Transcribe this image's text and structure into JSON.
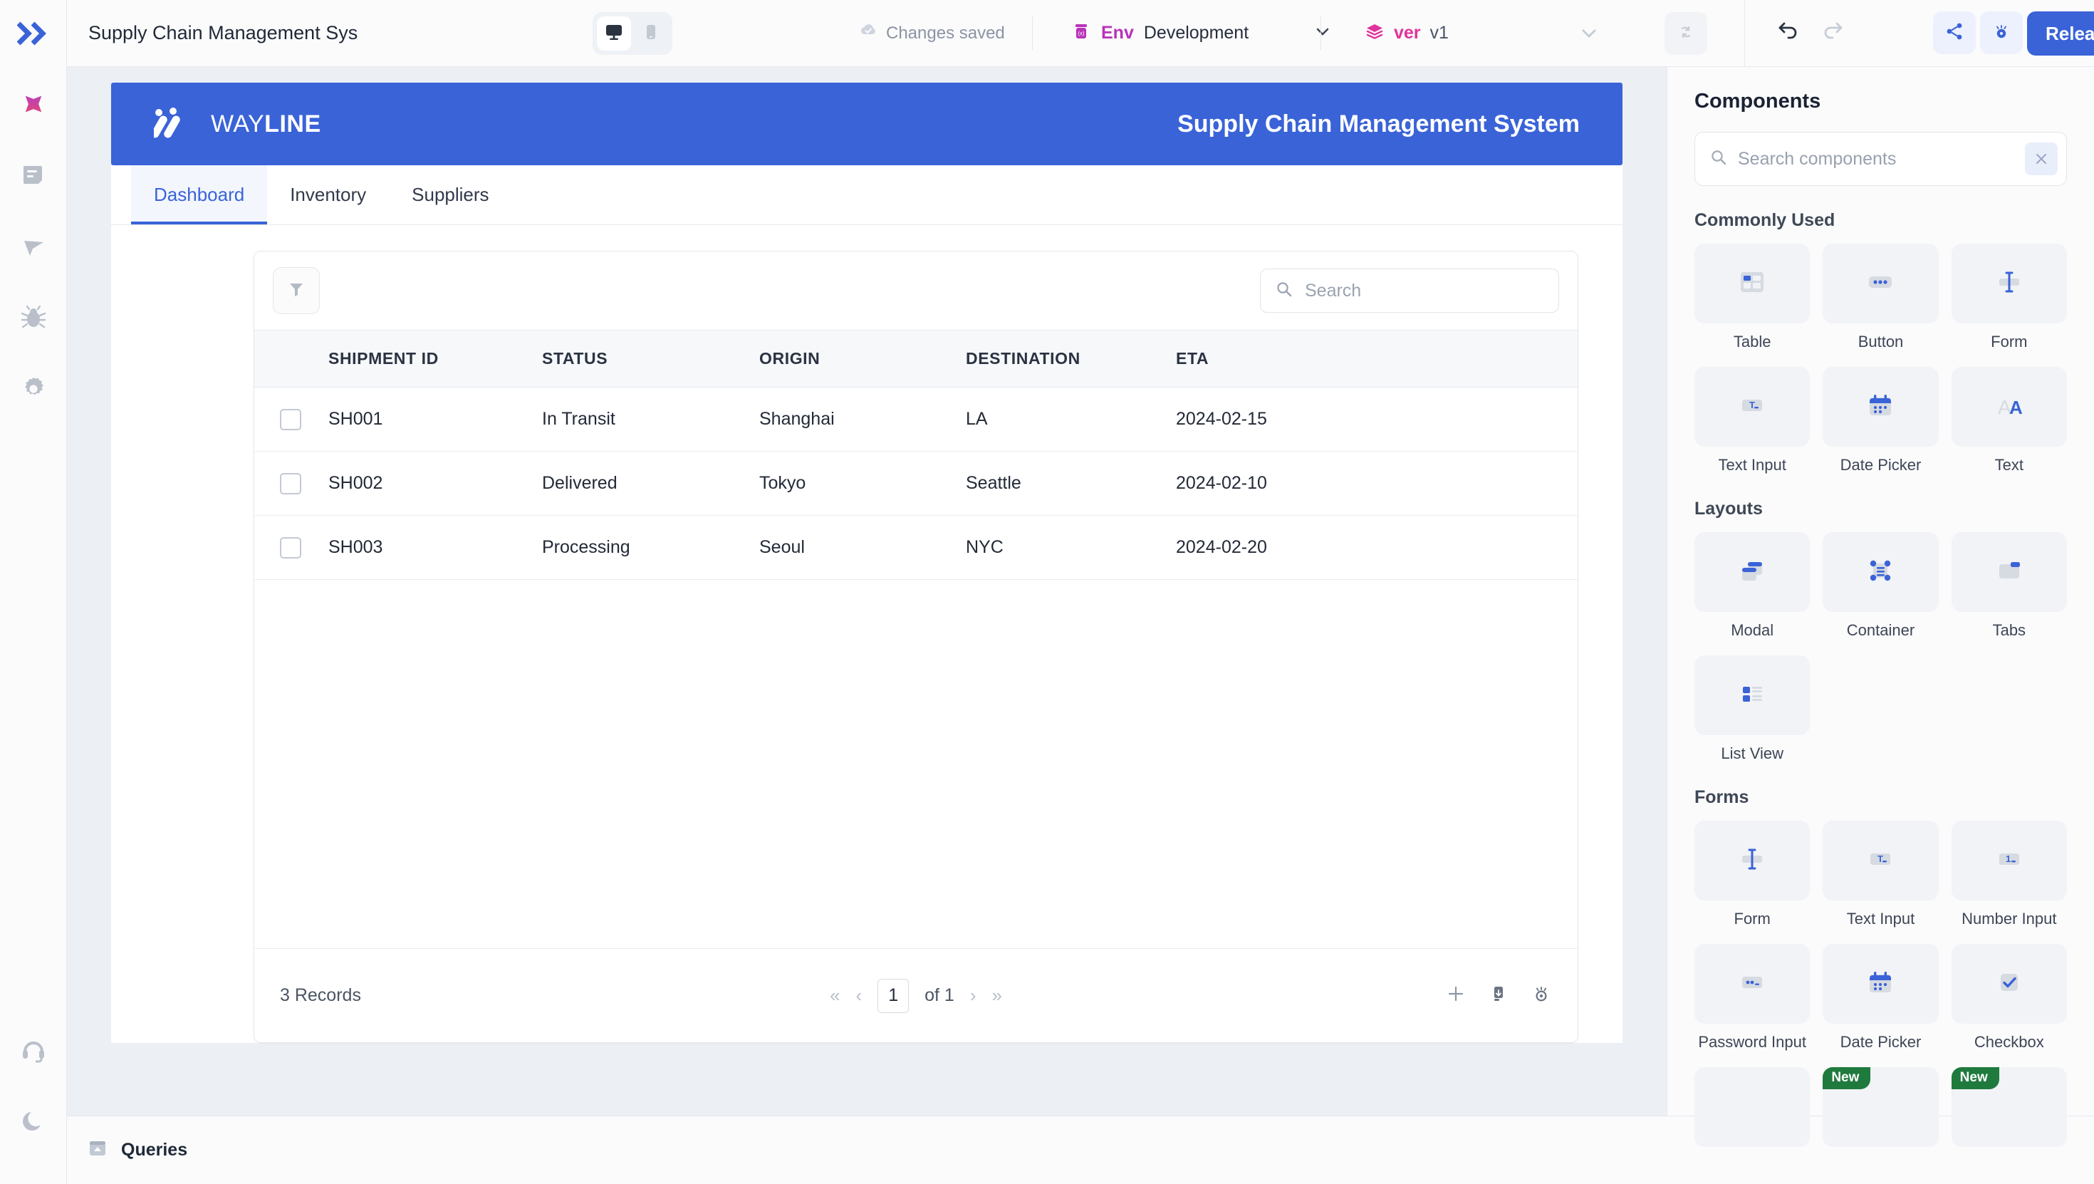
{
  "topbar": {
    "app_title": "Supply Chain Management Sys",
    "device_desktop_icon": "desktop-icon",
    "device_mobile_icon": "mobile-icon",
    "saved_status": "Changes saved",
    "saved_icon": "cloud-check-icon",
    "env_icon": "env-variable-icon",
    "env_label": "Env",
    "env_value": "Development",
    "env_caret_icon": "chevron-down-icon",
    "ver_icon": "layers-icon",
    "ver_label": "ver",
    "ver_value": "v1",
    "ver_caret_icon": "chevron-down-icon",
    "refresh_icon": "refresh-icon",
    "undo_icon": "undo-icon",
    "redo_icon": "redo-icon",
    "share_icon": "share-icon",
    "preview_icon": "preview-eye-icon",
    "release_label": "Release",
    "accent_blue": "#3a63d8",
    "env_purple": "#b832b8",
    "ver_pink": "#e0339b"
  },
  "rail": {
    "logo_icon": "wayline-chevrons-logo",
    "items": [
      {
        "name": "sidebar-item-apps",
        "icon": "sparkle-star-icon"
      },
      {
        "name": "sidebar-item-pages",
        "icon": "document-icon"
      },
      {
        "name": "sidebar-item-navigation",
        "icon": "cursor-pointer-icon"
      },
      {
        "name": "sidebar-item-debug",
        "icon": "bug-icon"
      },
      {
        "name": "sidebar-item-settings",
        "icon": "gear-icon"
      }
    ],
    "bottom_items": [
      {
        "name": "sidebar-item-support",
        "icon": "headset-icon"
      },
      {
        "name": "sidebar-item-theme",
        "icon": "moon-icon"
      }
    ]
  },
  "canvas": {
    "banner": {
      "brand_light": "WAY",
      "brand_bold": "LINE",
      "logo_icon": "wayline-slashes-logo",
      "title": "Supply Chain Management System",
      "background": "#3a63d8"
    },
    "tabs": [
      {
        "label": "Dashboard",
        "active": true
      },
      {
        "label": "Inventory",
        "active": false
      },
      {
        "label": "Suppliers",
        "active": false
      }
    ],
    "table": {
      "filter_icon": "filter-funnel-icon",
      "search_icon": "search-icon",
      "search_value": "",
      "search_placeholder": "Search",
      "columns": [
        "SHIPMENT ID",
        "STATUS",
        "ORIGIN",
        "DESTINATION",
        "ETA"
      ],
      "rows": [
        {
          "shipment_id": "SH001",
          "status": "In Transit",
          "origin": "Shanghai",
          "destination": "LA",
          "eta": "2024-02-15"
        },
        {
          "shipment_id": "SH002",
          "status": "Delivered",
          "origin": "Tokyo",
          "destination": "Seattle",
          "eta": "2024-02-10"
        },
        {
          "shipment_id": "SH003",
          "status": "Processing",
          "origin": "Seoul",
          "destination": "NYC",
          "eta": "2024-02-20"
        }
      ],
      "footer": {
        "records_label": "3 Records",
        "first_icon": "double-chevron-left-icon",
        "prev_icon": "chevron-left-icon",
        "page_value": "1",
        "of_label": "of 1",
        "next_icon": "chevron-right-icon",
        "last_icon": "double-chevron-right-icon",
        "add_icon": "plus-icon",
        "download_icon": "download-icon",
        "visibility_icon": "eye-icon"
      }
    }
  },
  "queries": {
    "icon": "queries-panel-icon",
    "label": "Queries"
  },
  "components_panel": {
    "title": "Components",
    "search_icon": "search-icon",
    "search_value": "",
    "search_placeholder": "Search components",
    "clear_icon": "close-x-icon",
    "sections": [
      {
        "title": "Commonly Used",
        "items": [
          {
            "label": "Table",
            "icon": "table-component-icon"
          },
          {
            "label": "Button",
            "icon": "button-component-icon"
          },
          {
            "label": "Form",
            "icon": "form-component-icon"
          },
          {
            "label": "Text Input",
            "icon": "text-input-component-icon"
          },
          {
            "label": "Date Picker",
            "icon": "date-picker-component-icon"
          },
          {
            "label": "Text",
            "icon": "text-component-icon"
          }
        ]
      },
      {
        "title": "Layouts",
        "items": [
          {
            "label": "Modal",
            "icon": "modal-component-icon"
          },
          {
            "label": "Container",
            "icon": "container-component-icon"
          },
          {
            "label": "Tabs",
            "icon": "tabs-component-icon"
          },
          {
            "label": "List View",
            "icon": "list-view-component-icon"
          }
        ]
      },
      {
        "title": "Forms",
        "items": [
          {
            "label": "Form",
            "icon": "form-component-icon"
          },
          {
            "label": "Text Input",
            "icon": "text-input-component-icon"
          },
          {
            "label": "Number Input",
            "icon": "number-input-component-icon"
          },
          {
            "label": "Password Input",
            "icon": "password-input-component-icon"
          },
          {
            "label": "Date Picker",
            "icon": "date-picker-component-icon"
          },
          {
            "label": "Checkbox",
            "icon": "checkbox-component-icon"
          },
          {
            "label": "",
            "icon": "partial-component-icon",
            "badge": ""
          },
          {
            "label": "",
            "icon": "partial-component-icon",
            "badge": "New"
          },
          {
            "label": "",
            "icon": "partial-component-icon",
            "badge": "New"
          }
        ]
      }
    ]
  }
}
